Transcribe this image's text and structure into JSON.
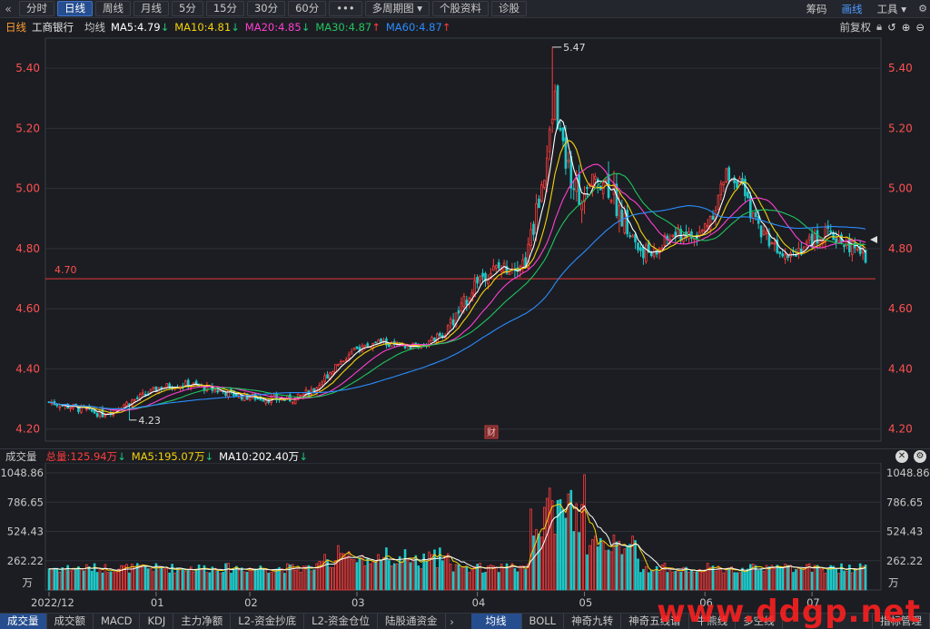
{
  "toolbar": {
    "back_icon": "chevron-left-icon",
    "periods": [
      "分时",
      "日线",
      "周线",
      "月线",
      "5分",
      "15分",
      "30分",
      "60分"
    ],
    "active_period": "日线",
    "more": "•••",
    "multi_period": "多周期图",
    "stock_info": "个股资料",
    "diagnose": "诊股",
    "chip": "筹码",
    "draw_line": "画线",
    "tools": "工具"
  },
  "indicator": {
    "period": "日线",
    "stock_name": "工商银行",
    "avg_line": "均线",
    "ma5": "MA5:4.79",
    "ma10": "MA10:4.81",
    "ma20": "MA20:4.85",
    "ma30": "MA30:4.87",
    "ma60": "MA60:4.87",
    "adjust": "前复权",
    "colors": {
      "ma5": "#ffffff",
      "ma10": "#f5d20a",
      "ma20": "#ff3fd0",
      "ma30": "#21c45f",
      "ma60": "#2b8cff"
    }
  },
  "volume_header": {
    "title": "成交量",
    "total": "总量:125.94万",
    "ma5": "MA5:195.07万",
    "ma10": "MA10:202.40万"
  },
  "badge": "财",
  "tabs": [
    "成交量",
    "成交额",
    "MACD",
    "KDJ",
    "主力净额",
    "L2-资金抄底",
    "L2-资金仓位",
    "陆股通资金"
  ],
  "active_tab": "成交量",
  "tabs_more": "›",
  "tabs_right": [
    "均线",
    "BOLL",
    "神奇九转",
    "神奇五线谱",
    "牛熊线",
    "多空线"
  ],
  "active_tab_right": "均线",
  "indicator_manage": "指标管理",
  "watermark": "www.ddgp.net",
  "chart_data": {
    "type": "candlestick",
    "price_axis": {
      "ticks": [
        "5.40",
        "5.20",
        "5.00",
        "4.80",
        "4.60",
        "4.40",
        "4.20"
      ],
      "ylim": [
        4.16,
        5.5
      ]
    },
    "hline": {
      "value": 4.7,
      "label": "4.70"
    },
    "high_label": "5.47",
    "low_label": "4.23",
    "volume_axis": {
      "ticks": [
        "1048.86",
        "786.65",
        "524.43",
        "262.22"
      ],
      "unit": "万"
    },
    "x_labels": [
      "2022/12",
      "01",
      "02",
      "03",
      "04",
      "05",
      "06",
      "07"
    ],
    "colors": {
      "up": "#ff3c3c",
      "down": "#1fc8c8",
      "grid": "#2e3138"
    },
    "series": [
      {
        "name": "MA5"
      },
      {
        "name": "MA10"
      },
      {
        "name": "MA20"
      },
      {
        "name": "MA30"
      },
      {
        "name": "MA60"
      }
    ]
  }
}
